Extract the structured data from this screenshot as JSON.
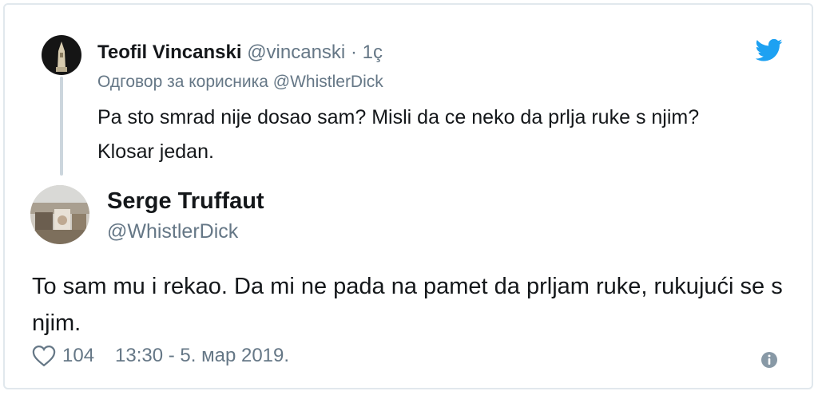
{
  "reply_tweet": {
    "author_name": "Teofil Vincanski",
    "author_handle": "@vincanski",
    "separator": "·",
    "time": "1ç",
    "reply_prefix": "Одговор за корисника",
    "reply_mention": "@WhistlerDick",
    "text": "Pa sto smrad nije dosao sam? Misli da ce neko da prlja ruke s njim? Klosar jedan."
  },
  "main_tweet": {
    "author_name": "Serge Truffaut",
    "author_handle": "@WhistlerDick",
    "text": "To sam mu i rekao. Da mi ne pada na pamet da prljam ruke, rukujući se s njim.",
    "likes": "104",
    "timestamp": "13:30 - 5. мар 2019."
  },
  "icons": {
    "brand": "twitter-bird-icon",
    "like": "heart-icon",
    "info": "info-icon"
  },
  "colors": {
    "brand_blue": "#1da1f2",
    "text_primary": "#14171a",
    "text_secondary": "#657786",
    "border": "#e1e8ed"
  }
}
